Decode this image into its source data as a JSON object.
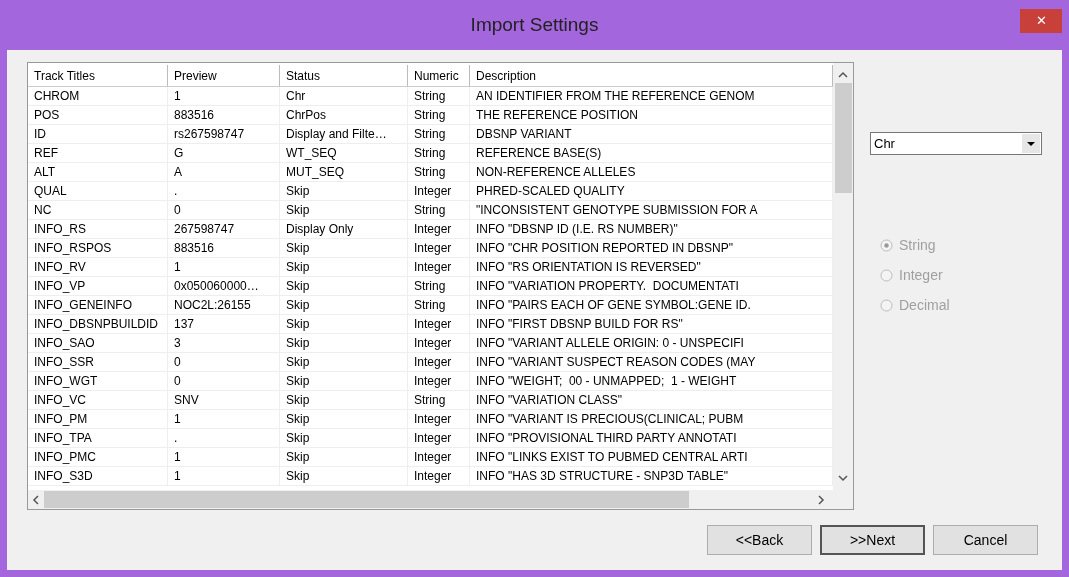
{
  "window": {
    "title": "Import Settings",
    "close": "✕"
  },
  "table": {
    "columns": [
      "Track Titles",
      "Preview",
      "Status",
      "Numeric",
      "Description"
    ],
    "rows": [
      [
        "CHROM",
        "1",
        "Chr",
        "String",
        "AN IDENTIFIER FROM THE REFERENCE GENOM"
      ],
      [
        "POS",
        "883516",
        "ChrPos",
        "String",
        "THE REFERENCE POSITION"
      ],
      [
        "ID",
        "rs267598747",
        "Display and Filte…",
        "String",
        "DBSNP VARIANT"
      ],
      [
        "REF",
        "G",
        "WT_SEQ",
        "String",
        "REFERENCE BASE(S)"
      ],
      [
        "ALT",
        "A",
        "MUT_SEQ",
        "String",
        "NON-REFERENCE ALLELES"
      ],
      [
        "QUAL",
        ".",
        "Skip",
        "Integer",
        "PHRED-SCALED QUALITY"
      ],
      [
        "NC",
        "0",
        "Skip",
        "String",
        "\"INCONSISTENT GENOTYPE SUBMISSION FOR A"
      ],
      [
        "INFO_RS",
        "267598747",
        "Display Only",
        "Integer",
        "INFO \"DBSNP ID (I.E. RS NUMBER)\""
      ],
      [
        "INFO_RSPOS",
        "883516",
        "Skip",
        "Integer",
        "INFO \"CHR POSITION REPORTED IN DBSNP\""
      ],
      [
        "INFO_RV",
        "1",
        "Skip",
        "Integer",
        "INFO \"RS ORIENTATION IS REVERSED\""
      ],
      [
        "INFO_VP",
        "0x050060000…",
        "Skip",
        "String",
        "INFO \"VARIATION PROPERTY.  DOCUMENTATI"
      ],
      [
        "INFO_GENEINFO",
        "NOC2L:26155",
        "Skip",
        "String",
        "INFO \"PAIRS EACH OF GENE SYMBOL:GENE ID."
      ],
      [
        "INFO_DBSNPBUILDID",
        "137",
        "Skip",
        "Integer",
        "INFO \"FIRST DBSNP BUILD FOR RS\""
      ],
      [
        "INFO_SAO",
        "3",
        "Skip",
        "Integer",
        "INFO \"VARIANT ALLELE ORIGIN: 0 - UNSPECIFI"
      ],
      [
        "INFO_SSR",
        "0",
        "Skip",
        "Integer",
        "INFO \"VARIANT SUSPECT REASON CODES (MAY"
      ],
      [
        "INFO_WGT",
        "0",
        "Skip",
        "Integer",
        "INFO \"WEIGHT;  00 - UNMAPPED;  1 - WEIGHT"
      ],
      [
        "INFO_VC",
        "SNV",
        "Skip",
        "String",
        "INFO \"VARIATION CLASS\""
      ],
      [
        "INFO_PM",
        "1",
        "Skip",
        "Integer",
        "INFO \"VARIANT IS PRECIOUS(CLINICAL; PUBM"
      ],
      [
        "INFO_TPA",
        ".",
        "Skip",
        "Integer",
        "INFO \"PROVISIONAL THIRD PARTY ANNOTATI"
      ],
      [
        "INFO_PMC",
        "1",
        "Skip",
        "Integer",
        "INFO \"LINKS EXIST TO PUBMED CENTRAL ARTI"
      ],
      [
        "INFO_S3D",
        "1",
        "Skip",
        "Integer",
        "INFO \"HAS 3D STRUCTURE - SNP3D TABLE\""
      ]
    ]
  },
  "dropdown": {
    "value": "Chr"
  },
  "radios": [
    {
      "label": "String",
      "selected": true,
      "disabled": true
    },
    {
      "label": "Integer",
      "selected": false,
      "disabled": true
    },
    {
      "label": "Decimal",
      "selected": false,
      "disabled": true
    }
  ],
  "buttons": [
    {
      "label": "<<Back",
      "default": false
    },
    {
      "label": ">>Next",
      "default": true
    },
    {
      "label": "Cancel",
      "default": false
    }
  ]
}
